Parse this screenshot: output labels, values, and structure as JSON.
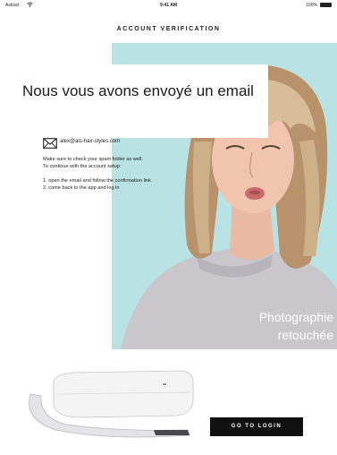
{
  "status_bar": {
    "carrier": "Astract",
    "time": "9:41 AM",
    "battery": "100%"
  },
  "header": {
    "title": "ACCOUNT VERIFICATION"
  },
  "headline": "Nous vous avons envoyé un email",
  "email_address": "alex@als-hair-styles.com",
  "instructions": {
    "line1": "Make sure to check your spam folder as well.",
    "line2": "To continue with the account setup:",
    "step1": "1. open the email and follow the confirmation link",
    "step2": "2. come back to the app and log in"
  },
  "photo": {
    "caption_line1": "Photographie",
    "caption_line2": "retouchée",
    "background_color": "#b8e2e3"
  },
  "icons": {
    "mail": "envelope-icon",
    "wifi": "wifi-icon",
    "battery": "battery-icon"
  },
  "actions": {
    "go_to_login": "GO TO LOGIN"
  }
}
